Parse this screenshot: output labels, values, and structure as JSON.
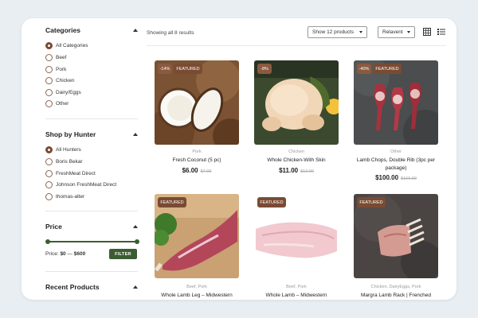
{
  "sidebar": {
    "categories": {
      "title": "Categories",
      "items": [
        "All Categories",
        "Beef",
        "Pork",
        "Chicken",
        "Dairy/Eggs",
        "Other"
      ],
      "selected": 0
    },
    "hunters": {
      "title": "Shop by Hunter",
      "items": [
        "All Hunters",
        "Boris Bekar",
        "FreshMeat Direct",
        "Johnson FreshMeat Direct",
        "thomas-alter"
      ],
      "selected": 0
    },
    "price": {
      "title": "Price",
      "label": "Price:",
      "min": "$0",
      "sep": "—",
      "max": "$600",
      "filter_label": "FILTER"
    },
    "recent": {
      "title": "Recent Products"
    }
  },
  "toolbar": {
    "result_count": "Showing all 8 results",
    "per_page": "Show 12 products",
    "sort": "Relavent"
  },
  "products": [
    {
      "sale_badge": "-14%",
      "featured": "FEATURED",
      "category": "Pork",
      "name": "Fresh Coconut (5 pc)",
      "price": "$6.00",
      "old_price": "$7.00"
    },
    {
      "sale_badge": "-8%",
      "featured": "",
      "category": "Chicken",
      "name": "Whole Chicken-With Skin",
      "price": "$11.00",
      "old_price": "$12.00"
    },
    {
      "sale_badge": "-40%",
      "featured": "FEATURED",
      "category": "Other",
      "name": "Lamb Chops, Double Rib (3pc per package)",
      "price": "$100.00",
      "old_price": "$166.99"
    },
    {
      "sale_badge": "",
      "featured": "FEATURED",
      "category": "Beef, Pork",
      "name": "Whole Lamb Leg – Midwestern",
      "price": "",
      "old_price": ""
    },
    {
      "sale_badge": "",
      "featured": "FEATURED",
      "category": "Beef, Pork",
      "name": "Whole Lamb – Midwestern",
      "price": "",
      "old_price": ""
    },
    {
      "sale_badge": "",
      "featured": "FEATURED",
      "category": "Chicken, DairyEggs, Pork",
      "name": "Margra Lamb Rack | Frenched",
      "price": "",
      "old_price": ""
    }
  ],
  "colors": {
    "accent_brown": "#7a4b33",
    "accent_green": "#3c5d32",
    "background": "#e8eef2"
  },
  "icons": [
    "caret-up-icon",
    "chevron-down-icon",
    "grid-view-icon",
    "list-view-icon"
  ]
}
